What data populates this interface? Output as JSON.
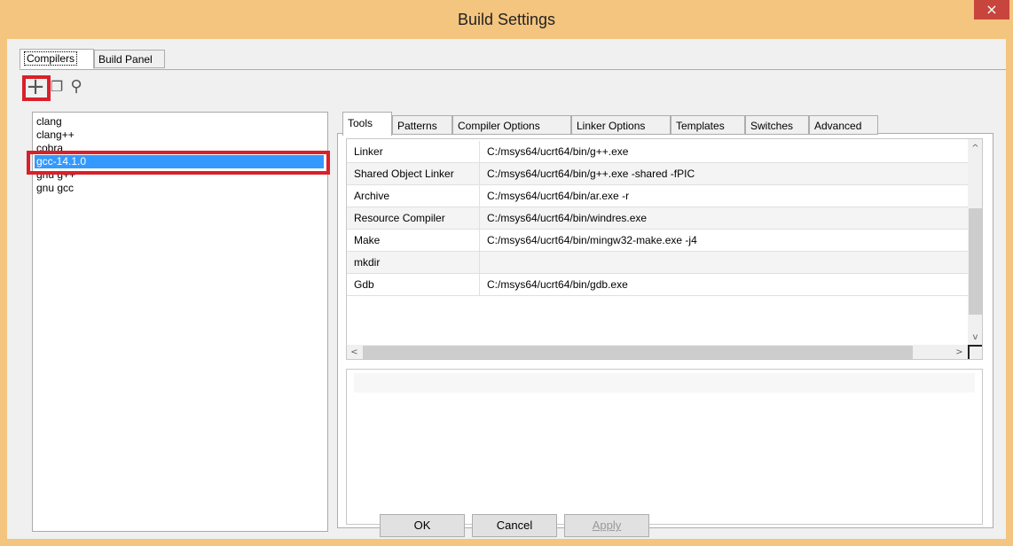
{
  "window": {
    "title": "Build Settings",
    "close_glyph": "×"
  },
  "outer_tabs": [
    {
      "label": "Compilers"
    },
    {
      "label": "Build Panel"
    }
  ],
  "toolbar": {
    "icons": [
      "add-icon",
      "copy-icon",
      "search-icon"
    ],
    "glyphs": {
      "add": "+",
      "copy": "❐",
      "search": "⚲"
    }
  },
  "compilers": {
    "items": [
      "clang",
      "clang++",
      "cobra",
      "gcc-14.1.0",
      "gnu g++",
      "gnu gcc"
    ],
    "selected": "gcc-14.1.0"
  },
  "inner_tabs": [
    "Tools",
    "Patterns",
    "Compiler Options",
    "Linker Options",
    "Templates",
    "Switches",
    "Advanced"
  ],
  "tools": [
    {
      "name": "Linker",
      "value": "C:/msys64/ucrt64/bin/g++.exe"
    },
    {
      "name": "Shared Object Linker",
      "value": "C:/msys64/ucrt64/bin/g++.exe -shared -fPIC"
    },
    {
      "name": "Archive",
      "value": "C:/msys64/ucrt64/bin/ar.exe -r"
    },
    {
      "name": "Resource Compiler",
      "value": "C:/msys64/ucrt64/bin/windres.exe"
    },
    {
      "name": "Make",
      "value": "C:/msys64/ucrt64/bin/mingw32-make.exe -j4"
    },
    {
      "name": "mkdir",
      "value": ""
    },
    {
      "name": "Gdb",
      "value": "C:/msys64/ucrt64/bin/gdb.exe"
    }
  ],
  "scroll": {
    "up": "^",
    "down": "v",
    "left": "<",
    "right": ">"
  },
  "buttons": {
    "ok": "OK",
    "cancel": "Cancel",
    "apply": "Apply"
  },
  "colors": {
    "highlight": "#d9202a",
    "selection": "#3399ff",
    "title_bar": "#f4c57f",
    "close": "#c7453c"
  }
}
